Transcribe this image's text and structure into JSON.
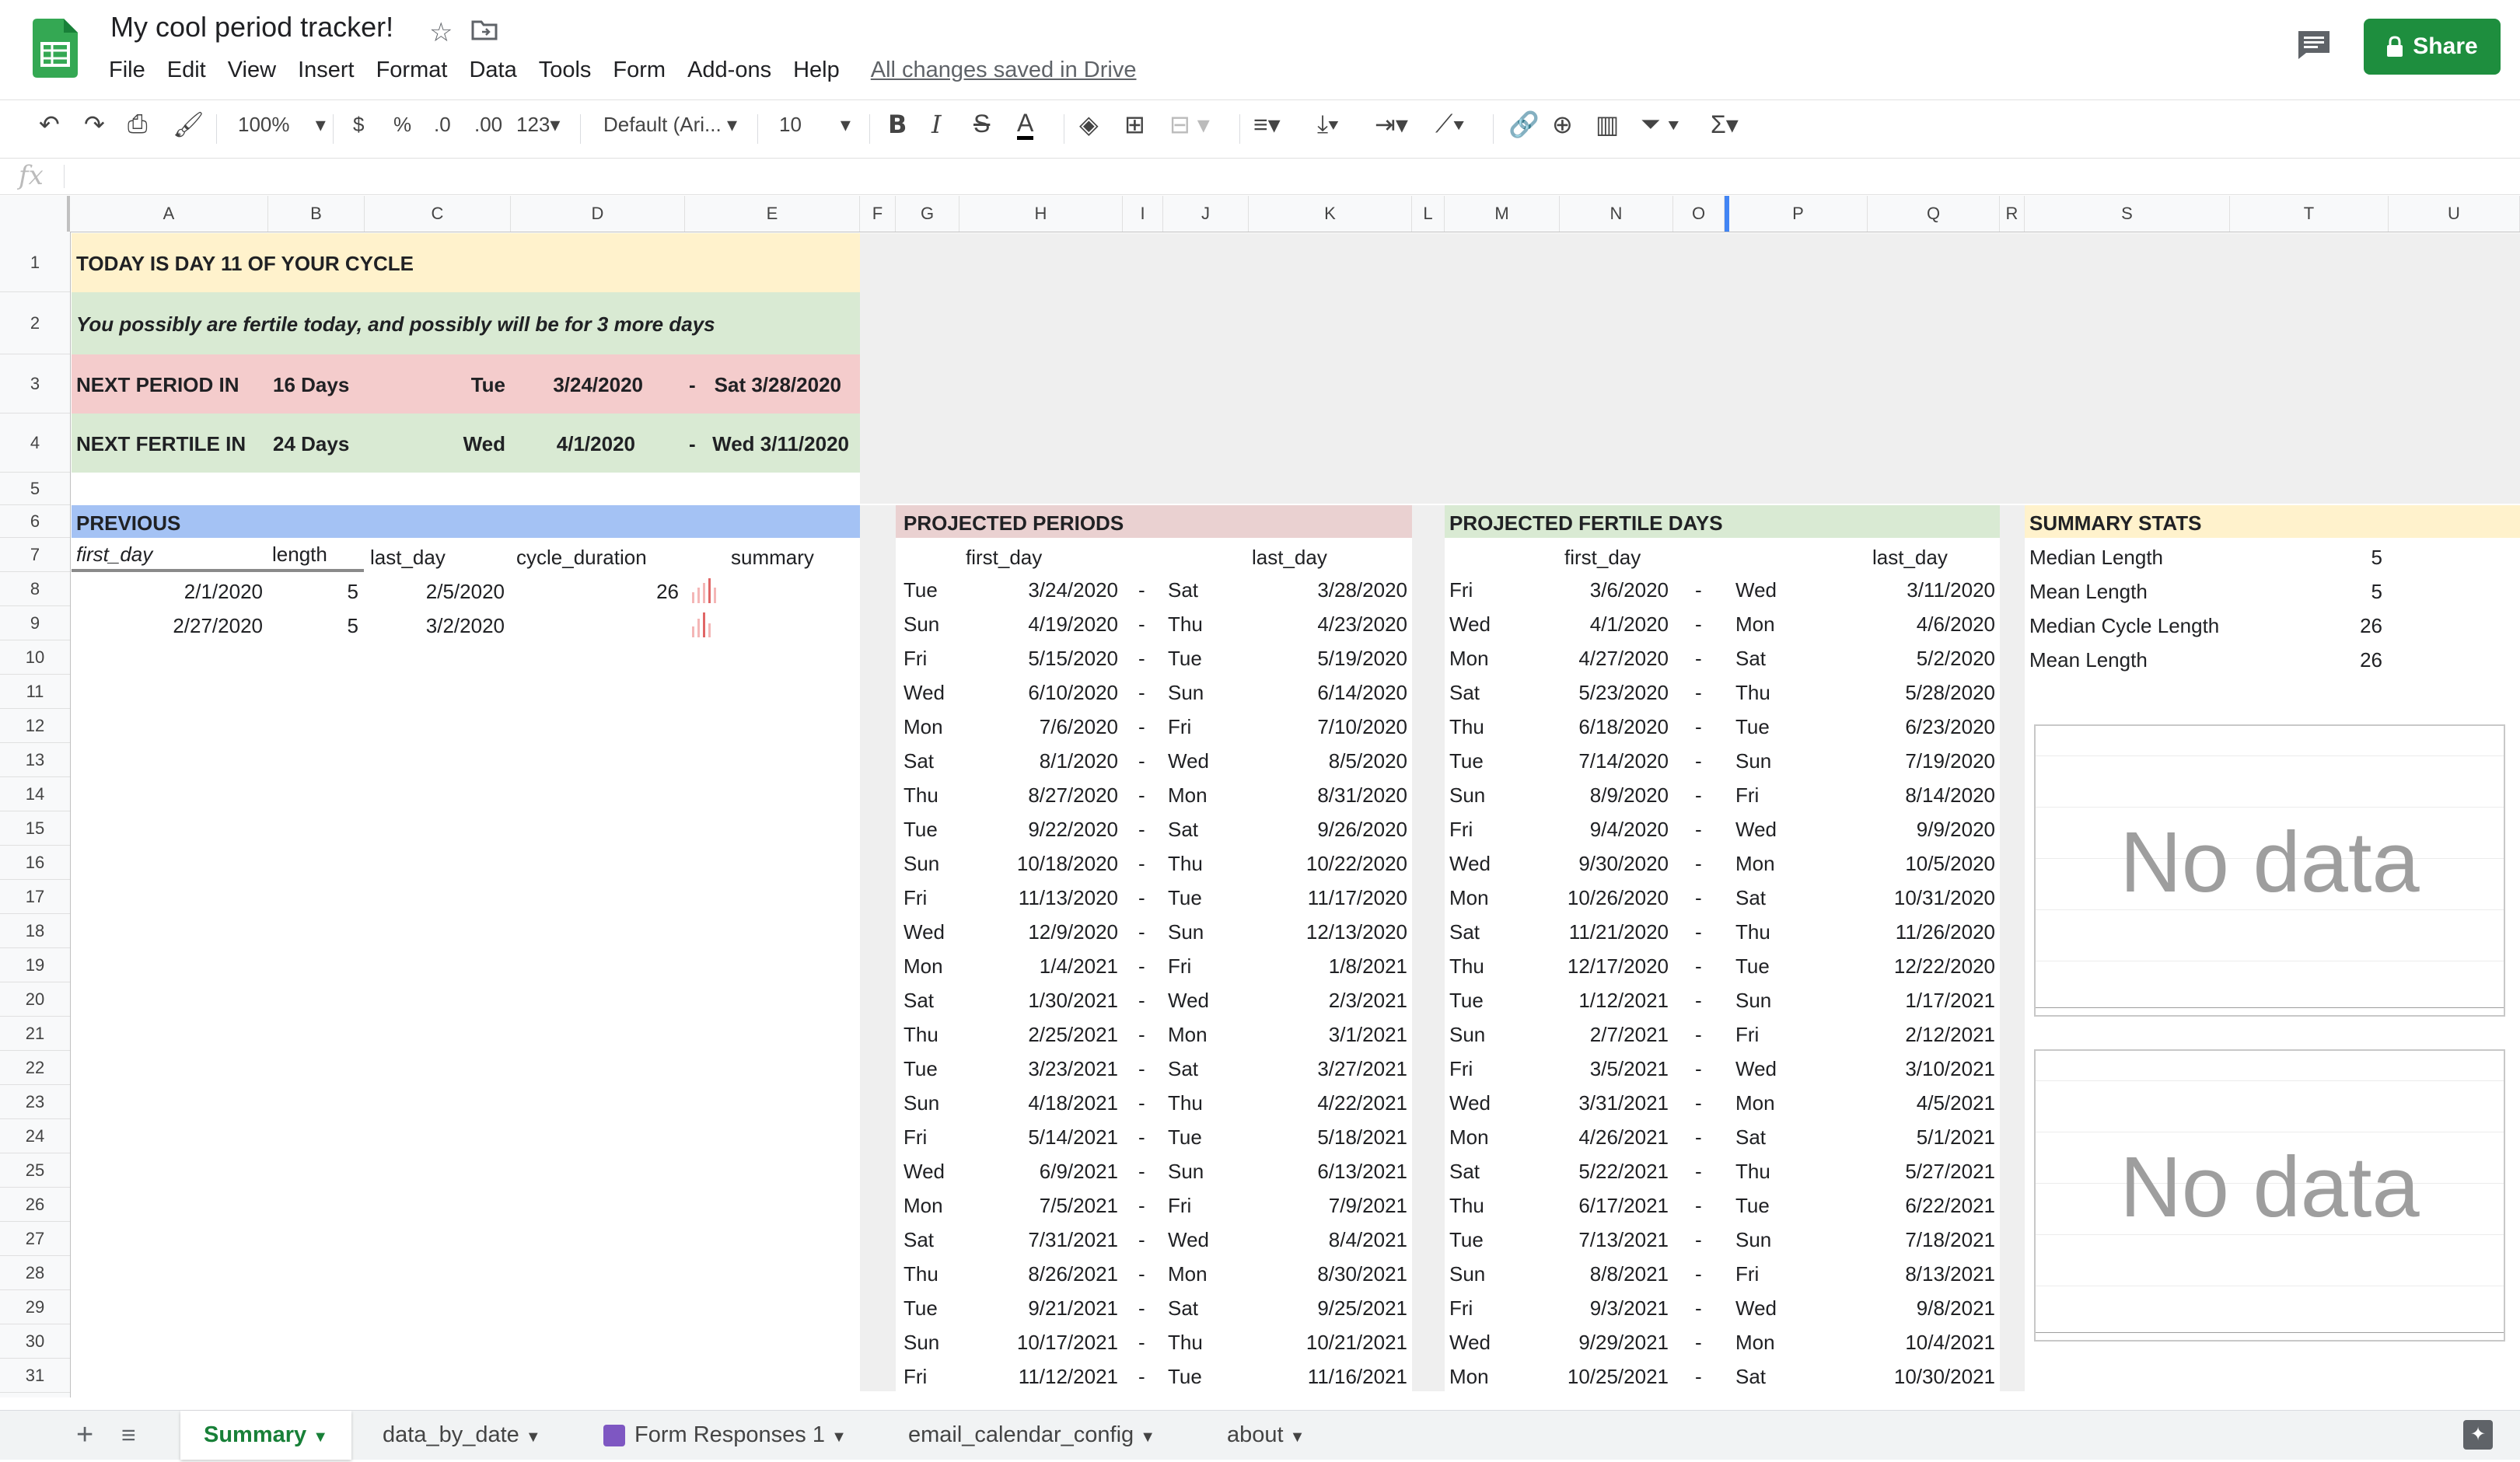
{
  "app": {
    "title": "My cool period tracker!",
    "menu": [
      "File",
      "Edit",
      "View",
      "Insert",
      "Format",
      "Data",
      "Tools",
      "Form",
      "Add-ons",
      "Help"
    ],
    "save_status": "All changes saved in Drive",
    "share_label": "Share",
    "accent": "#1e8e3e"
  },
  "toolbar": {
    "zoom": "100%",
    "currency": "$",
    "percent": "%",
    "dec_less": ".0",
    "dec_more": ".00",
    "number_format": "123",
    "font": "Default (Ari...",
    "font_size": "10"
  },
  "columns": [
    "A",
    "B",
    "C",
    "D",
    "E",
    "F",
    "G",
    "H",
    "I",
    "J",
    "K",
    "L",
    "M",
    "N",
    "O",
    "P",
    "Q",
    "R",
    "S",
    "T",
    "U"
  ],
  "rows": [
    "1",
    "2",
    "3",
    "4",
    "5",
    "6",
    "7",
    "8",
    "9",
    "10",
    "11",
    "12",
    "13",
    "14",
    "15",
    "16",
    "17",
    "18",
    "19",
    "20",
    "21",
    "22",
    "23",
    "24",
    "25",
    "26",
    "27",
    "28",
    "29",
    "30",
    "31"
  ],
  "banner": {
    "today": "TODAY IS DAY 11 OF YOUR CYCLE",
    "fertile_note": "You possibly are fertile today, and possibly will be for 3 more days",
    "next_period": {
      "label": "NEXT PERIOD IN",
      "days": "16 Days",
      "dow": "Tue",
      "date": "3/24/2020",
      "dash": "-",
      "end": "Sat 3/28/2020"
    },
    "next_fertile": {
      "label": "NEXT FERTILE  IN",
      "days": "24 Days",
      "dow": "Wed",
      "date": "4/1/2020",
      "dash": "-",
      "end": "Wed 3/11/2020"
    }
  },
  "previous": {
    "header": "PREVIOUS",
    "columns": [
      "first_day",
      "length",
      "last_day",
      "cycle_duration",
      "summary"
    ],
    "rows": [
      {
        "first_day": "2/1/2020",
        "length": "5",
        "last_day": "2/5/2020",
        "cycle_duration": "26"
      },
      {
        "first_day": "2/27/2020",
        "length": "5",
        "last_day": "3/2/2020",
        "cycle_duration": ""
      }
    ]
  },
  "projected_periods": {
    "header": "PROJECTED PERIODS",
    "col_first": "first_day",
    "col_last": "last_day",
    "rows": [
      [
        "Tue",
        "3/24/2020",
        "Sat",
        "3/28/2020"
      ],
      [
        "Sun",
        "4/19/2020",
        "Thu",
        "4/23/2020"
      ],
      [
        "Fri",
        "5/15/2020",
        "Tue",
        "5/19/2020"
      ],
      [
        "Wed",
        "6/10/2020",
        "Sun",
        "6/14/2020"
      ],
      [
        "Mon",
        "7/6/2020",
        "Fri",
        "7/10/2020"
      ],
      [
        "Sat",
        "8/1/2020",
        "Wed",
        "8/5/2020"
      ],
      [
        "Thu",
        "8/27/2020",
        "Mon",
        "8/31/2020"
      ],
      [
        "Tue",
        "9/22/2020",
        "Sat",
        "9/26/2020"
      ],
      [
        "Sun",
        "10/18/2020",
        "Thu",
        "10/22/2020"
      ],
      [
        "Fri",
        "11/13/2020",
        "Tue",
        "11/17/2020"
      ],
      [
        "Wed",
        "12/9/2020",
        "Sun",
        "12/13/2020"
      ],
      [
        "Mon",
        "1/4/2021",
        "Fri",
        "1/8/2021"
      ],
      [
        "Sat",
        "1/30/2021",
        "Wed",
        "2/3/2021"
      ],
      [
        "Thu",
        "2/25/2021",
        "Mon",
        "3/1/2021"
      ],
      [
        "Tue",
        "3/23/2021",
        "Sat",
        "3/27/2021"
      ],
      [
        "Sun",
        "4/18/2021",
        "Thu",
        "4/22/2021"
      ],
      [
        "Fri",
        "5/14/2021",
        "Tue",
        "5/18/2021"
      ],
      [
        "Wed",
        "6/9/2021",
        "Sun",
        "6/13/2021"
      ],
      [
        "Mon",
        "7/5/2021",
        "Fri",
        "7/9/2021"
      ],
      [
        "Sat",
        "7/31/2021",
        "Wed",
        "8/4/2021"
      ],
      [
        "Thu",
        "8/26/2021",
        "Mon",
        "8/30/2021"
      ],
      [
        "Tue",
        "9/21/2021",
        "Sat",
        "9/25/2021"
      ],
      [
        "Sun",
        "10/17/2021",
        "Thu",
        "10/21/2021"
      ],
      [
        "Fri",
        "11/12/2021",
        "Tue",
        "11/16/2021"
      ]
    ]
  },
  "projected_fertile": {
    "header": "PROJECTED FERTILE DAYS",
    "col_first": "first_day",
    "col_last": "last_day",
    "rows": [
      [
        "Fri",
        "3/6/2020",
        "Wed",
        "3/11/2020"
      ],
      [
        "Wed",
        "4/1/2020",
        "Mon",
        "4/6/2020"
      ],
      [
        "Mon",
        "4/27/2020",
        "Sat",
        "5/2/2020"
      ],
      [
        "Sat",
        "5/23/2020",
        "Thu",
        "5/28/2020"
      ],
      [
        "Thu",
        "6/18/2020",
        "Tue",
        "6/23/2020"
      ],
      [
        "Tue",
        "7/14/2020",
        "Sun",
        "7/19/2020"
      ],
      [
        "Sun",
        "8/9/2020",
        "Fri",
        "8/14/2020"
      ],
      [
        "Fri",
        "9/4/2020",
        "Wed",
        "9/9/2020"
      ],
      [
        "Wed",
        "9/30/2020",
        "Mon",
        "10/5/2020"
      ],
      [
        "Mon",
        "10/26/2020",
        "Sat",
        "10/31/2020"
      ],
      [
        "Sat",
        "11/21/2020",
        "Thu",
        "11/26/2020"
      ],
      [
        "Thu",
        "12/17/2020",
        "Tue",
        "12/22/2020"
      ],
      [
        "Tue",
        "1/12/2021",
        "Sun",
        "1/17/2021"
      ],
      [
        "Sun",
        "2/7/2021",
        "Fri",
        "2/12/2021"
      ],
      [
        "Fri",
        "3/5/2021",
        "Wed",
        "3/10/2021"
      ],
      [
        "Wed",
        "3/31/2021",
        "Mon",
        "4/5/2021"
      ],
      [
        "Mon",
        "4/26/2021",
        "Sat",
        "5/1/2021"
      ],
      [
        "Sat",
        "5/22/2021",
        "Thu",
        "5/27/2021"
      ],
      [
        "Thu",
        "6/17/2021",
        "Tue",
        "6/22/2021"
      ],
      [
        "Tue",
        "7/13/2021",
        "Sun",
        "7/18/2021"
      ],
      [
        "Sun",
        "8/8/2021",
        "Fri",
        "8/13/2021"
      ],
      [
        "Fri",
        "9/3/2021",
        "Wed",
        "9/8/2021"
      ],
      [
        "Wed",
        "9/29/2021",
        "Mon",
        "10/4/2021"
      ],
      [
        "Mon",
        "10/25/2021",
        "Sat",
        "10/30/2021"
      ]
    ]
  },
  "summary_stats": {
    "header": "SUMMARY STATS",
    "rows": [
      {
        "label": "Median Length",
        "value": "5"
      },
      {
        "label": "Mean Length",
        "value": "5"
      },
      {
        "label": "Median Cycle Length",
        "value": "26"
      },
      {
        "label": "Mean Length",
        "value": "26"
      }
    ]
  },
  "charts": [
    {
      "message": "No data"
    },
    {
      "message": "No data"
    }
  ],
  "sheet_tabs": [
    "Summary",
    "data_by_date",
    "Form Responses 1",
    "email_calendar_config",
    "about"
  ],
  "colors": {
    "banner_yellow": "#fff2cc",
    "banner_green": "#d9ead3",
    "banner_red": "#f4cccc",
    "previous_blue": "#a4c2f4",
    "period_pink": "#ead1d1",
    "fertile_green": "#d9ead3",
    "stats_yellow": "#fff2cc"
  }
}
